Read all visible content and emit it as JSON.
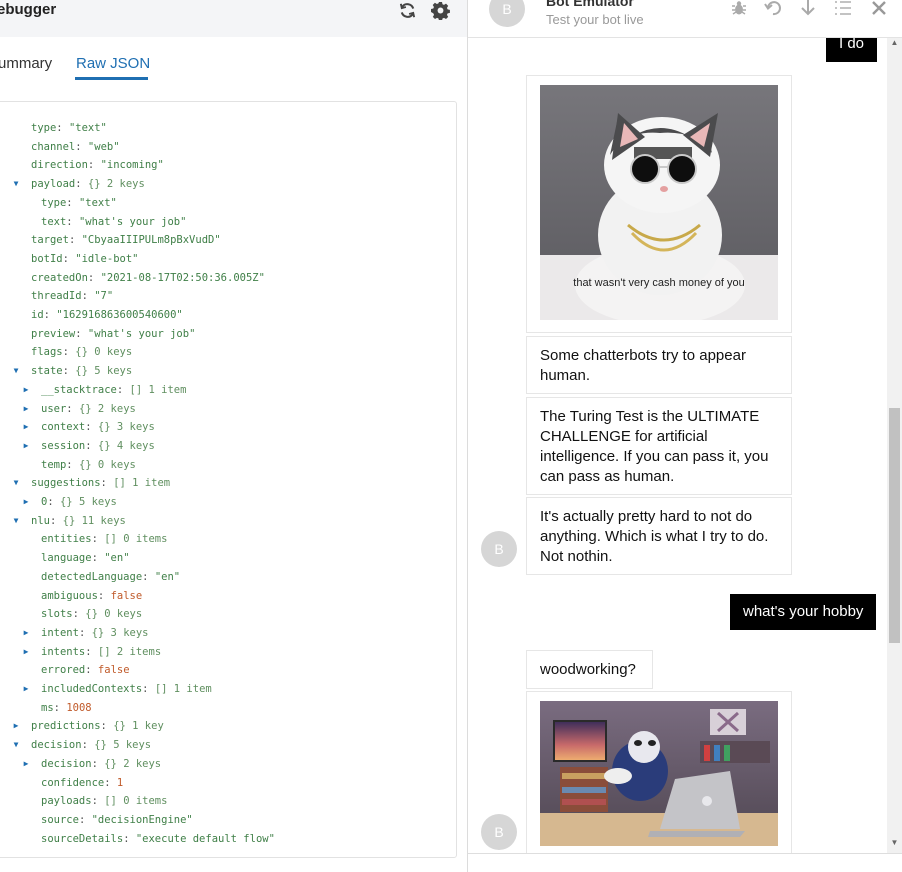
{
  "debugger": {
    "title": "ebugger",
    "refresh_icon": "refresh-icon",
    "settings_icon": "gear-icon",
    "tabs": [
      {
        "label": "ummary"
      },
      {
        "label": "Raw JSON"
      }
    ],
    "json_rows": [
      {
        "key": "type",
        "value": "\"text\"",
        "kind": "str",
        "depth": 1,
        "arrow": ""
      },
      {
        "key": "channel",
        "value": "\"web\"",
        "kind": "str",
        "depth": 1,
        "arrow": ""
      },
      {
        "key": "direction",
        "value": "\"incoming\"",
        "kind": "str",
        "depth": 1,
        "arrow": ""
      },
      {
        "key": "payload",
        "value": "{} 2 keys",
        "kind": "meta",
        "depth": 1,
        "arrow": "down"
      },
      {
        "key": "type",
        "value": "\"text\"",
        "kind": "str",
        "depth": 2,
        "arrow": ""
      },
      {
        "key": "text",
        "value": "\"what's your job\"",
        "kind": "str",
        "depth": 2,
        "arrow": ""
      },
      {
        "key": "target",
        "value": "\"CbyaaIIIPULm8pBxVudD\"",
        "kind": "str",
        "depth": 1,
        "arrow": ""
      },
      {
        "key": "botId",
        "value": "\"idle-bot\"",
        "kind": "str",
        "depth": 1,
        "arrow": ""
      },
      {
        "key": "createdOn",
        "value": "\"2021-08-17T02:50:36.005Z\"",
        "kind": "str",
        "depth": 1,
        "arrow": ""
      },
      {
        "key": "threadId",
        "value": "\"7\"",
        "kind": "str",
        "depth": 1,
        "arrow": ""
      },
      {
        "key": "id",
        "value": "\"162916863600540600\"",
        "kind": "str",
        "depth": 1,
        "arrow": ""
      },
      {
        "key": "preview",
        "value": "\"what's your job\"",
        "kind": "str",
        "depth": 1,
        "arrow": ""
      },
      {
        "key": "flags",
        "value": "{} 0 keys",
        "kind": "meta",
        "depth": 1,
        "arrow": ""
      },
      {
        "key": "state",
        "value": "{} 5 keys",
        "kind": "meta",
        "depth": 1,
        "arrow": "down"
      },
      {
        "key": "__stacktrace",
        "value": "[] 1 item",
        "kind": "meta",
        "depth": 2,
        "arrow": "right"
      },
      {
        "key": "user",
        "value": "{} 2 keys",
        "kind": "meta",
        "depth": 2,
        "arrow": "right"
      },
      {
        "key": "context",
        "value": "{} 3 keys",
        "kind": "meta",
        "depth": 2,
        "arrow": "right"
      },
      {
        "key": "session",
        "value": "{} 4 keys",
        "kind": "meta",
        "depth": 2,
        "arrow": "right"
      },
      {
        "key": "temp",
        "value": "{} 0 keys",
        "kind": "meta",
        "depth": 2,
        "arrow": ""
      },
      {
        "key": "suggestions",
        "value": "[] 1 item",
        "kind": "meta",
        "depth": 1,
        "arrow": "down"
      },
      {
        "key": "0",
        "value": "{} 5 keys",
        "kind": "meta",
        "depth": 2,
        "arrow": "right"
      },
      {
        "key": "nlu",
        "value": "{} 11 keys",
        "kind": "meta",
        "depth": 1,
        "arrow": "down"
      },
      {
        "key": "entities",
        "value": "[] 0 items",
        "kind": "meta",
        "depth": 2,
        "arrow": ""
      },
      {
        "key": "language",
        "value": "\"en\"",
        "kind": "str",
        "depth": 2,
        "arrow": ""
      },
      {
        "key": "detectedLanguage",
        "value": "\"en\"",
        "kind": "str",
        "depth": 2,
        "arrow": ""
      },
      {
        "key": "ambiguous",
        "value": "false",
        "kind": "bool",
        "depth": 2,
        "arrow": ""
      },
      {
        "key": "slots",
        "value": "{} 0 keys",
        "kind": "meta",
        "depth": 2,
        "arrow": ""
      },
      {
        "key": "intent",
        "value": "{} 3 keys",
        "kind": "meta",
        "depth": 2,
        "arrow": "right"
      },
      {
        "key": "intents",
        "value": "[] 2 items",
        "kind": "meta",
        "depth": 2,
        "arrow": "right"
      },
      {
        "key": "errored",
        "value": "false",
        "kind": "bool",
        "depth": 2,
        "arrow": ""
      },
      {
        "key": "includedContexts",
        "value": "[] 1 item",
        "kind": "meta",
        "depth": 2,
        "arrow": "right"
      },
      {
        "key": "ms",
        "value": "1008",
        "kind": "num",
        "depth": 2,
        "arrow": ""
      },
      {
        "key": "predictions",
        "value": "{} 1 key",
        "kind": "meta",
        "depth": 1,
        "arrow": "right"
      },
      {
        "key": "decision",
        "value": "{} 5 keys",
        "kind": "meta",
        "depth": 1,
        "arrow": "down"
      },
      {
        "key": "decision",
        "value": "{} 2 keys",
        "kind": "meta",
        "depth": 2,
        "arrow": "right"
      },
      {
        "key": "confidence",
        "value": "1",
        "kind": "num",
        "depth": 2,
        "arrow": ""
      },
      {
        "key": "payloads",
        "value": "[] 0 items",
        "kind": "meta",
        "depth": 2,
        "arrow": ""
      },
      {
        "key": "source",
        "value": "\"decisionEngine\"",
        "kind": "str",
        "depth": 2,
        "arrow": ""
      },
      {
        "key": "sourceDetails",
        "value": "\"execute default flow\"",
        "kind": "str",
        "depth": 2,
        "arrow": ""
      }
    ]
  },
  "emulator": {
    "avatar_letter": "B",
    "title": "Bot Emulator",
    "subtitle": "Test your bot live",
    "tools": [
      "bug-icon",
      "undo-icon",
      "download-icon",
      "list-icon",
      "close-icon"
    ],
    "messages": {
      "user_top": "I do",
      "image1_caption": "that wasn't very cash money of you",
      "bot1": "Some chatterbots try to appear human.",
      "bot2": "The Turing Test is the ULTIMATE CHALLENGE for artificial intelligence. If you can pass it, you can pass as human.",
      "bot3": "It's actually pretty hard to not do anything. Which is what I try to do. Not nothin.",
      "user_hobby": "what's your hobby",
      "bot4": "woodworking?"
    },
    "colors": {
      "accent": "#1f6fb2",
      "user_bubble": "#000000"
    }
  }
}
